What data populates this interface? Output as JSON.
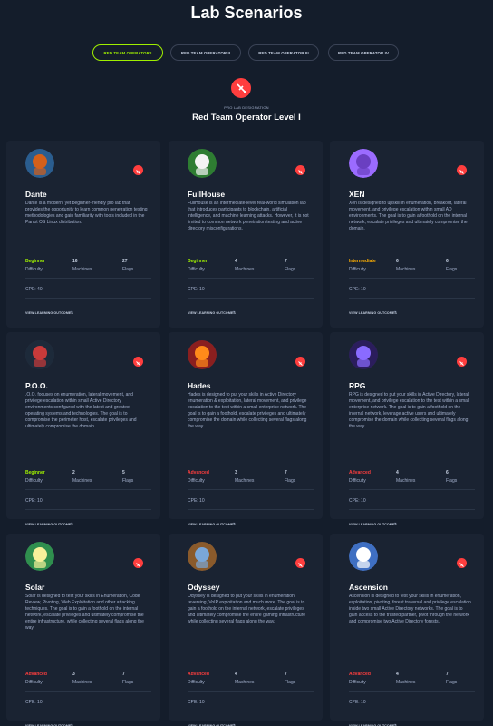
{
  "page": {
    "title": "Lab Scenarios"
  },
  "tabs": [
    "RED TEAM OPERATOR I",
    "RED TEAM OPERATOR II",
    "RED TEAM OPERATOR III",
    "RED TEAM OPERATOR IV"
  ],
  "section": {
    "pro_label": "PRO LAB DESIGNATION",
    "title": "Red Team Operator Level I"
  },
  "labels": {
    "difficulty": "Difficulty",
    "machines": "Machines",
    "flags": "Flags",
    "view_outcomes": "VIEW LEARNING OUTCOMES"
  },
  "colors": {
    "background": "#141d2b",
    "card": "#1a2332",
    "accent_green": "#9fef00",
    "beginner": "#9fef00",
    "intermediate": "#ffaf00",
    "advanced": "#ff3e3e",
    "badge": "#ff3e3e"
  },
  "labs": [
    {
      "name": "Dante",
      "icon": "dante-avatar",
      "description": "Dante is a modern, yet beginner-friendly pro lab that provides the opportunity to learn common penetration testing methodologies and gain familiarity with tools included in the Parrot OS Linux distribution.",
      "difficulty": "Beginner",
      "machines": "16",
      "flags": "27",
      "cpe": "CPE: 40"
    },
    {
      "name": "FullHouse",
      "icon": "fullhouse-avatar",
      "description": "FullHouse is an intermediate-level real-world simulation lab that introduces participants to blockchain, artificial intelligence, and machine learning attacks. However, it is not limited to common network penetration testing and active directory misconfigurations.",
      "difficulty": "Beginner",
      "machines": "4",
      "flags": "7",
      "cpe": "CPE: 10"
    },
    {
      "name": "XEN",
      "icon": "xen-avatar",
      "description": "Xen is designed to upskill in enumeration, breakout, lateral movement, and privilege escalation within small AD environments. The goal is to gain a foothold on the internal network, escalate privileges and ultimately compromise the domain.",
      "difficulty": "Intermediate",
      "machines": "6",
      "flags": "6",
      "cpe": "CPE: 10"
    },
    {
      "name": "P.O.O.",
      "icon": "poo-avatar",
      "description": ".O.O. focuses on enumeration, lateral movement, and privilege escalation within small Active Directory environments configured with the latest and greatest operating systems and technologies. The goal is to compromise the perimeter host, escalate privileges and ultimately compromise the domain.",
      "difficulty": "Beginner",
      "machines": "2",
      "flags": "5",
      "cpe": "CPE: 10"
    },
    {
      "name": "Hades",
      "icon": "hades-avatar",
      "description": "Hades is designed to put your skills in Active Directory enumeration & exploitation, lateral movement, and privilege escalation to the test within a small enterprise network. The goal is to gain a foothold, escalate privileges and ultimately compromise the domain while collecting several flags along the way.",
      "difficulty": "Advanced",
      "machines": "3",
      "flags": "7",
      "cpe": "CPE: 10"
    },
    {
      "name": "RPG",
      "icon": "rpg-avatar",
      "description": "RPG is designed to put your skills in Active Directory, lateral movement, and privilege escalation to the test within a small enterprise network. The goal is to gain a foothold on the internal network, leverage active users and ultimately compromise the domain while collecting several flags along the way.",
      "difficulty": "Advanced",
      "machines": "4",
      "flags": "6",
      "cpe": "CPE: 10"
    },
    {
      "name": "Solar",
      "icon": "solar-avatar",
      "description": "Solar is designed to test your skills in Enumeration, Code Review, Pivoting, Web Exploitation and other attacking techniques. The goal is to gain a foothold on the internal network, escalate privileges and ultimately compromise the entire infrastructure, while collecting several flags along the way.",
      "difficulty": "Advanced",
      "machines": "3",
      "flags": "7",
      "cpe": "CPE: 10"
    },
    {
      "name": "Odyssey",
      "icon": "odyssey-avatar",
      "description": "Odyssey is designed to put your skills in enumeration, reversing, VoIP exploitation and much more. The goal is to gain a foothold on the internal network, escalate privileges and ultimately compromise the entire gaming infrastructure while collecting several flags along the way.",
      "difficulty": "Advanced",
      "machines": "4",
      "flags": "7",
      "cpe": "CPE: 10"
    },
    {
      "name": "Ascension",
      "icon": "ascension-avatar",
      "description": "Ascension is designed to test your skills in enumeration, exploitation, pivoting, forest traversal and privilege escalation inside two small Active Directory networks. The goal is to gain access to the trusted partner, pivot through the network and compromise two Active Directory forests.",
      "difficulty": "Advanced",
      "machines": "4",
      "flags": "7",
      "cpe": "CPE: 10"
    }
  ]
}
